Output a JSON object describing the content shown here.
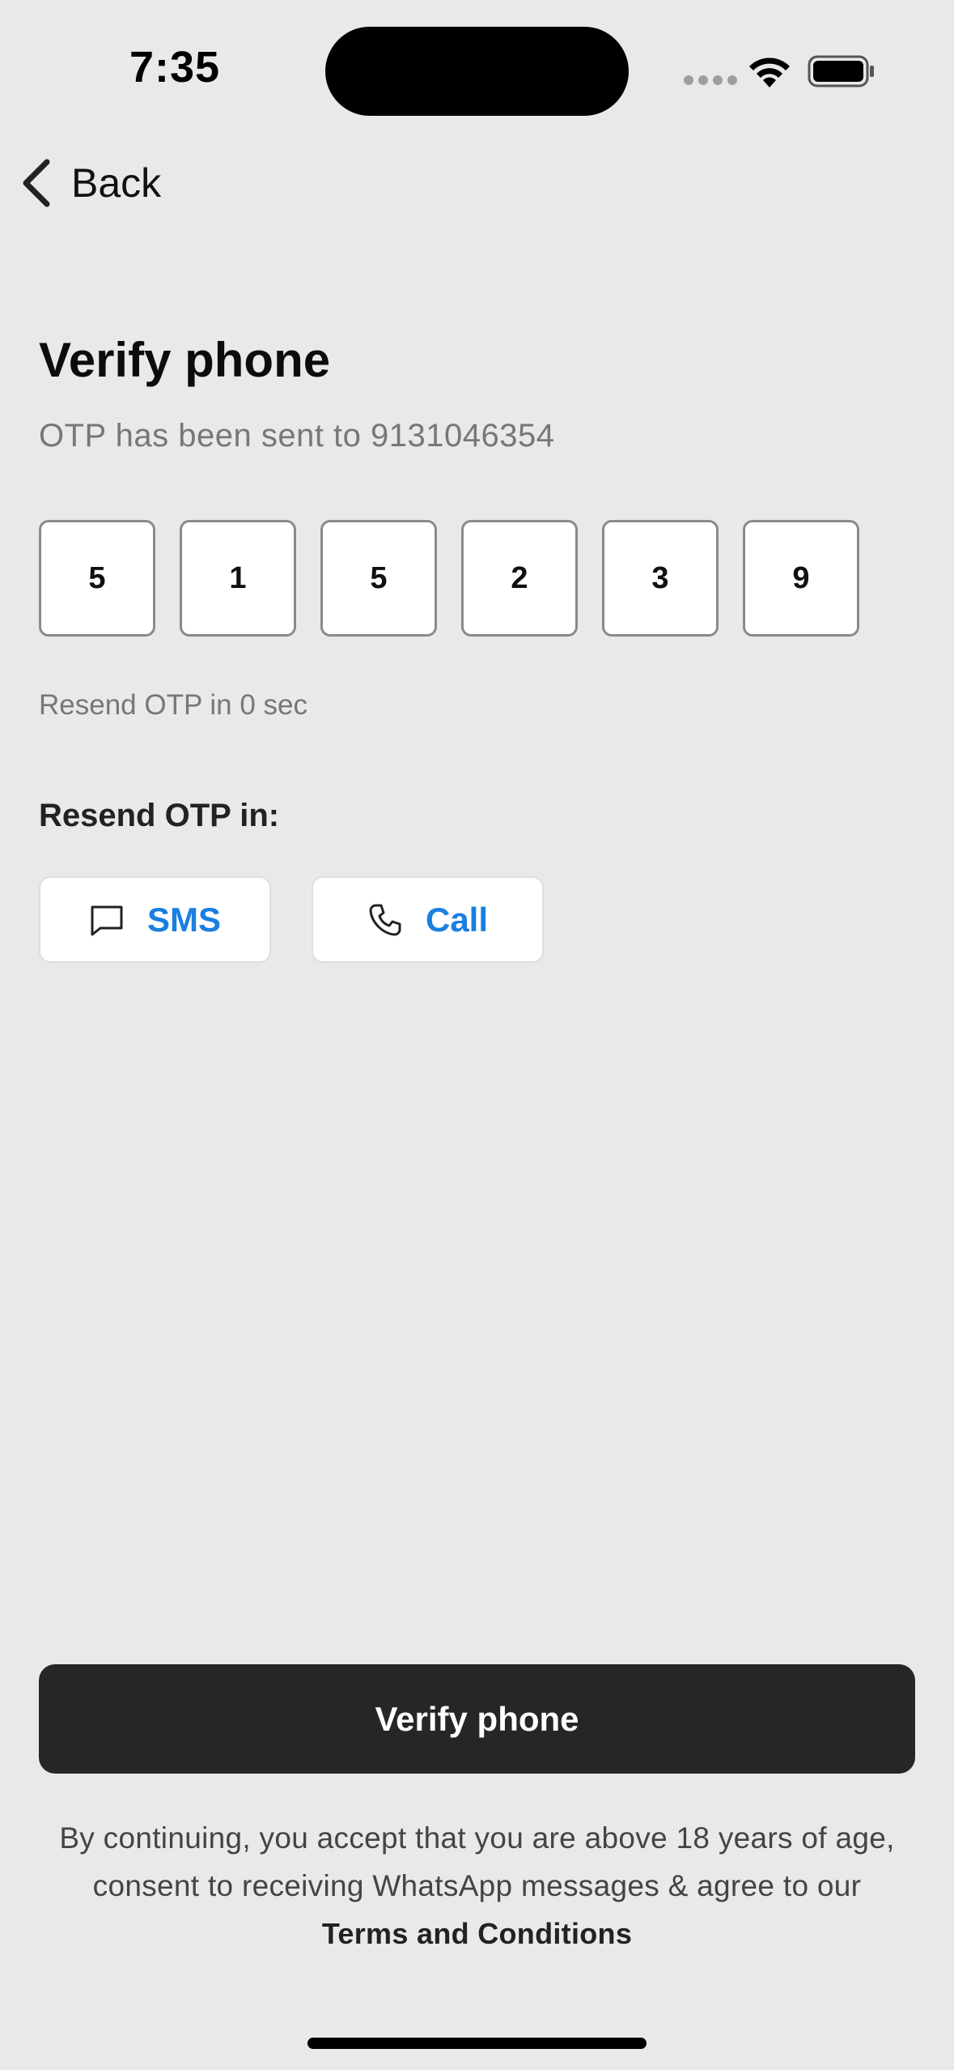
{
  "status_bar": {
    "time": "7:35",
    "icons": [
      "signal-dots-icon",
      "wifi-icon",
      "battery-icon"
    ]
  },
  "nav": {
    "back_label": "Back",
    "back_icon": "chevron-left-icon"
  },
  "header": {
    "title": "Verify phone",
    "subtitle": "OTP has been sent to 9131046354"
  },
  "otp": {
    "digits": [
      "5",
      "1",
      "5",
      "2",
      "3",
      "9"
    ]
  },
  "timer": {
    "text": "Resend OTP in 0 sec"
  },
  "resend": {
    "heading": "Resend OTP in:",
    "options": [
      {
        "label": "SMS",
        "icon": "message-icon"
      },
      {
        "label": "Call",
        "icon": "phone-icon"
      }
    ]
  },
  "primary_action": {
    "label": "Verify phone"
  },
  "footer": {
    "line1": "By continuing, you accept that you are above 18 years of age,",
    "line2": "consent to receiving WhatsApp messages & agree to our",
    "terms_link": "Terms and Conditions"
  },
  "colors": {
    "background": "#e9e9e9",
    "accent": "#1a7fe0",
    "button": "#262626"
  }
}
